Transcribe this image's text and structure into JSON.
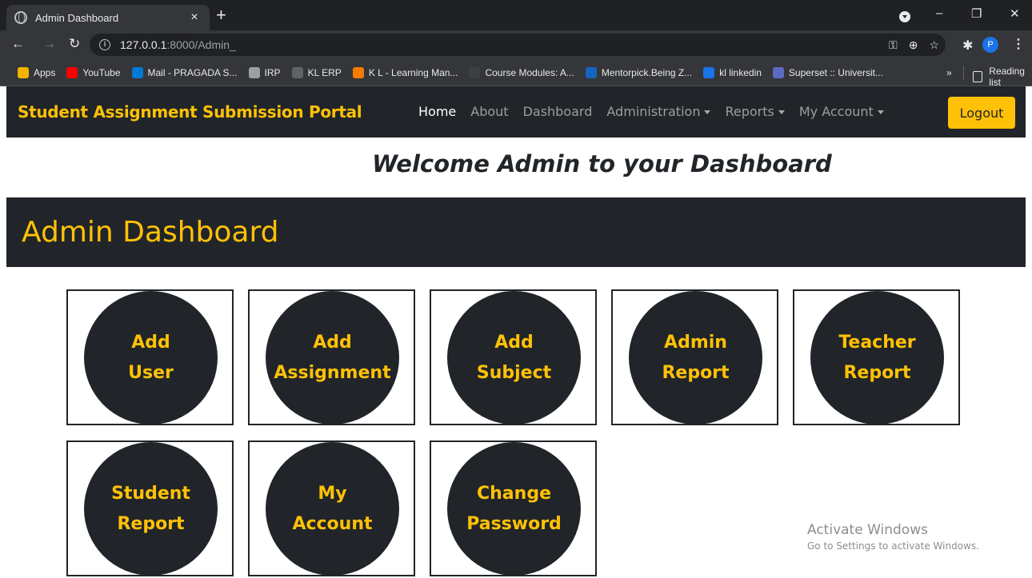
{
  "browser": {
    "tab_title": "Admin Dashboard",
    "tab_close": "×",
    "new_tab": "+",
    "url_host": "127.0.0.1",
    "url_path": ":8000/Admin_",
    "minimize": "–",
    "restore": "❐",
    "close": "✕",
    "profile_initial": "P",
    "bookmarks": [
      {
        "label": "Apps",
        "color": "#f4b400"
      },
      {
        "label": "YouTube",
        "color": "#ff0000"
      },
      {
        "label": "Mail - PRAGADA S...",
        "color": "#0078d4"
      },
      {
        "label": "IRP",
        "color": "#9aa0a6"
      },
      {
        "label": "KL ERP",
        "color": "#5f6368"
      },
      {
        "label": "K L - Learning Man...",
        "color": "#f57c00"
      },
      {
        "label": "Course Modules: A...",
        "color": "#3c4043"
      },
      {
        "label": "Mentorpick.Being Z...",
        "color": "#1565c0"
      },
      {
        "label": "kl linkedin",
        "color": "#1a73e8"
      },
      {
        "label": "Superset :: Universit...",
        "color": "#5c6bc0"
      }
    ],
    "more": "»",
    "reading_list": "Reading list"
  },
  "site": {
    "brand": "Student Assignment Submission Portal",
    "nav": {
      "home": "Home",
      "about": "About",
      "dashboard": "Dashboard",
      "administration": "Administration",
      "reports": "Reports",
      "my_account": "My Account"
    },
    "logout": "Logout",
    "welcome": "Welcome Admin to your Dashboard",
    "dashboard_title": "Admin Dashboard"
  },
  "tiles": [
    {
      "line1": "Add",
      "line2": "User"
    },
    {
      "line1": "Add",
      "line2": "Assignment"
    },
    {
      "line1": "Add",
      "line2": "Subject"
    },
    {
      "line1": "Admin",
      "line2": "Report"
    },
    {
      "line1": "Teacher",
      "line2": "Report"
    },
    {
      "line1": "Student",
      "line2": "Report"
    },
    {
      "line1": "My",
      "line2": "Account"
    },
    {
      "line1": "Change",
      "line2": "Password"
    }
  ],
  "watermark": {
    "line1": "Activate Windows",
    "line2": "Go to Settings to activate Windows."
  }
}
